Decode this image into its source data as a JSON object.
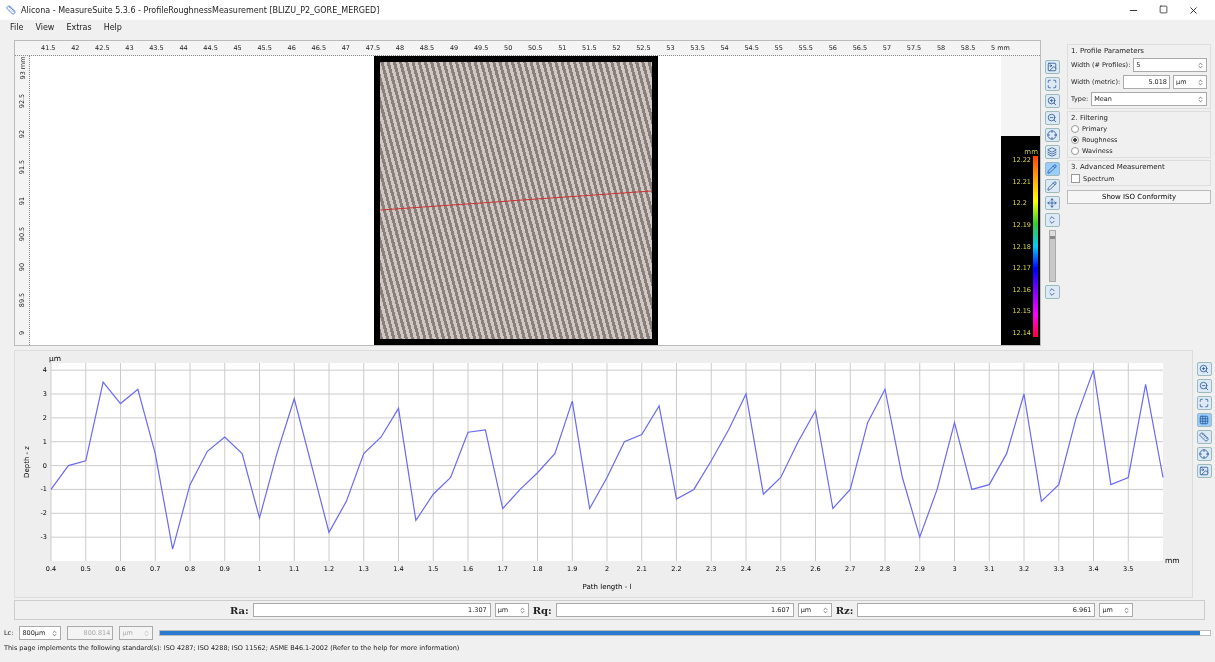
{
  "window": {
    "title": "Alicona - MeasureSuite 5.3.6 - ProfileRoughnessMeasurement  [BLIZU_P2_GORE_MERGED]"
  },
  "menu": [
    "File",
    "View",
    "Extras",
    "Help"
  ],
  "image_view": {
    "x_ruler": [
      "41.5",
      "42",
      "42.5",
      "43",
      "43.5",
      "44",
      "44.5",
      "45",
      "45.5",
      "46",
      "46.5",
      "47",
      "47.5",
      "48",
      "48.5",
      "49",
      "49.5",
      "50",
      "50.5",
      "51",
      "51.5",
      "52",
      "52.5",
      "53",
      "53.5",
      "54",
      "54.5",
      "55",
      "55.5",
      "56",
      "56.5",
      "57",
      "57.5",
      "58",
      "58.5",
      "5 mm"
    ],
    "y_ruler": [
      "93 mm",
      "92.5",
      "92",
      "91.5",
      "91",
      "90.5",
      "90",
      "89.5",
      "9"
    ],
    "zoom_slider": {
      "level": 0.85
    },
    "colorbar": {
      "unit": "mm",
      "labels": [
        "12.22",
        "12.21",
        "12.2",
        "12.19",
        "12.18",
        "12.17",
        "12.16",
        "12.15",
        "12.14"
      ]
    }
  },
  "profile_parameters": {
    "heading": "1. Profile Parameters",
    "width_profiles": {
      "label": "Width (# Profiles):",
      "value": "5"
    },
    "width_metric": {
      "label": "Width (metric):",
      "value": "5.018",
      "unit": "µm"
    },
    "type": {
      "label": "Type:",
      "value": "Mean"
    }
  },
  "filtering": {
    "heading": "2. Filtering",
    "options": [
      {
        "label": "Primary",
        "selected": false
      },
      {
        "label": "Roughness",
        "selected": true
      },
      {
        "label": "Waviness",
        "selected": false
      }
    ]
  },
  "advanced": {
    "heading": "3. Advanced Measurement",
    "options": [
      {
        "label": "Spectrum",
        "checked": false
      }
    ]
  },
  "iso_button": "Show ISO Conformity",
  "profile": {
    "y_unit": "µm",
    "x_unit": "mm",
    "chart_data": {
      "type": "line",
      "grid": true,
      "xlabel": "Path length - l",
      "ylabel": "Depth - z",
      "xlim": [
        0.4,
        3.6
      ],
      "ylim": [
        -4,
        4.3
      ],
      "xticks": [
        0.4,
        0.5,
        0.6,
        0.7,
        0.8,
        0.9,
        1,
        1.1,
        1.2,
        1.3,
        1.4,
        1.5,
        1.6,
        1.7,
        1.8,
        1.9,
        2,
        2.1,
        2.2,
        2.3,
        2.4,
        2.5,
        2.6,
        2.7,
        2.8,
        2.9,
        3,
        3.1,
        3.2,
        3.3,
        3.4,
        3.5
      ],
      "yticks": [
        -3,
        -2,
        -1,
        0,
        1,
        2,
        3,
        4
      ],
      "x": [
        0.4,
        0.45,
        0.5,
        0.55,
        0.6,
        0.65,
        0.7,
        0.75,
        0.8,
        0.85,
        0.9,
        0.95,
        1,
        1.05,
        1.1,
        1.15,
        1.2,
        1.25,
        1.3,
        1.35,
        1.4,
        1.45,
        1.5,
        1.55,
        1.6,
        1.65,
        1.7,
        1.75,
        1.8,
        1.85,
        1.9,
        1.95,
        2,
        2.05,
        2.1,
        2.15,
        2.2,
        2.25,
        2.3,
        2.35,
        2.4,
        2.45,
        2.5,
        2.55,
        2.6,
        2.65,
        2.7,
        2.75,
        2.8,
        2.85,
        2.9,
        2.95,
        3,
        3.05,
        3.1,
        3.15,
        3.2,
        3.25,
        3.3,
        3.35,
        3.4,
        3.45,
        3.5,
        3.55,
        3.6
      ],
      "series": [
        {
          "color": "#6a6af0",
          "values": [
            -1,
            0,
            0.2,
            3.5,
            2.6,
            3.2,
            0.5,
            -3.5,
            -0.8,
            0.6,
            1.2,
            0.5,
            -2.2,
            0.5,
            2.8,
            0,
            -2.8,
            -1.5,
            0.5,
            1.2,
            2.4,
            -2.3,
            -1.2,
            -0.5,
            1.4,
            1.5,
            -1.8,
            -1,
            -0.3,
            0.5,
            2.7,
            -1.8,
            -0.5,
            1,
            1.3,
            2.5,
            -1.4,
            -1,
            0.2,
            1.5,
            3,
            -1.2,
            -0.5,
            1,
            2.3,
            -1.8,
            -1,
            1.8,
            3.2,
            -0.5,
            -3,
            -1,
            1.8,
            -1,
            -0.8,
            0.5,
            3,
            -1.5,
            -0.8,
            2,
            4,
            -0.8,
            -0.5,
            3.4,
            -0.5
          ]
        }
      ]
    }
  },
  "results": [
    {
      "label": "Ra:",
      "value": "1.307",
      "unit": "µm"
    },
    {
      "label": "Rq:",
      "value": "1.607",
      "unit": "µm"
    },
    {
      "label": "Rz:",
      "value": "6.961",
      "unit": "µm"
    }
  ],
  "lc": {
    "label": "Lc:",
    "value": "800µm",
    "readout": "800.814",
    "unit": "µm",
    "level": 0.99
  },
  "status": "This page implements the following standard(s): ISO 4287; ISO 4288; ISO 11562; ASME B46.1-2002 (Refer to the help for more information)"
}
